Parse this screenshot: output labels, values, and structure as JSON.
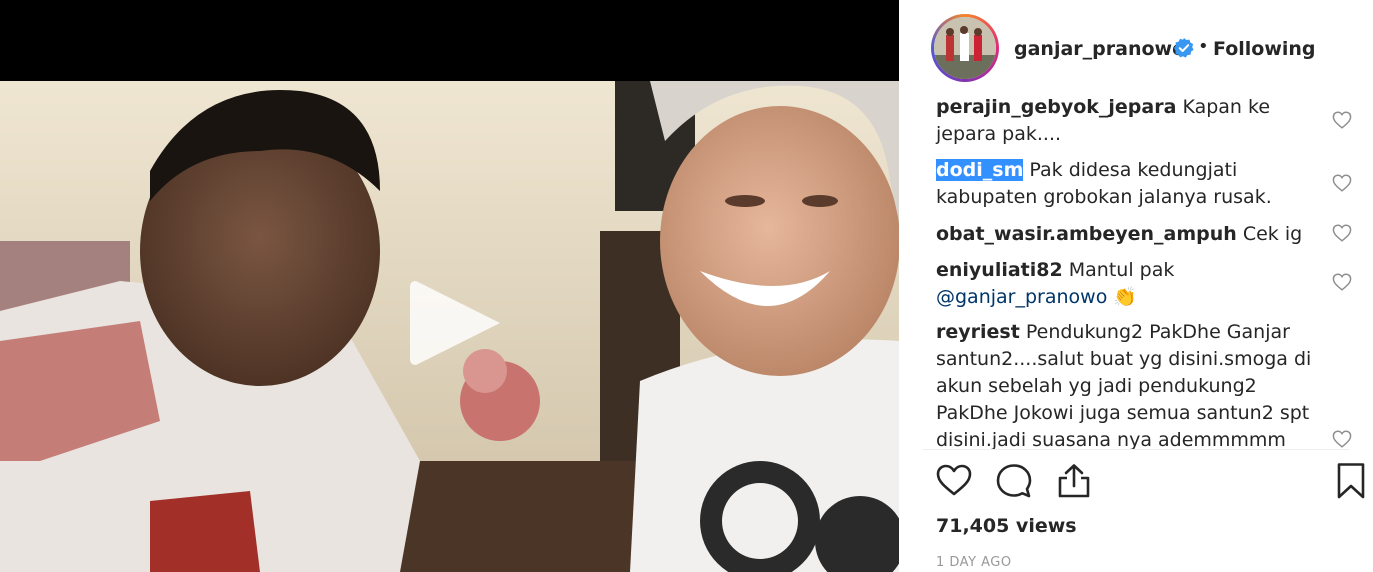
{
  "post": {
    "username": "ganjar_pranowo",
    "follow_separator": "•",
    "follow_status": "Following",
    "views": "71,405 views",
    "time_ago": "1 DAY AGO"
  },
  "comments": [
    {
      "user": "perajin_gebyok_jepara",
      "text": " Kapan ke jepara pak...."
    },
    {
      "user": "dodi_sm",
      "text": " Pak didesa kedungjati kabupaten grobokan jalanya rusak."
    },
    {
      "user": "obat_wasir.ambeyen_ampuh",
      "text": " Cek ig"
    },
    {
      "user": "eniyuliati82",
      "text": " Mantul pak",
      "mention": "@ganjar_pranowo",
      "emoji": "👏"
    },
    {
      "user": "reyriest",
      "text": " Pendukung2 PakDhe Ganjar santun2....salut buat yg disini.smoga di akun sebelah yg jadi pendukung2 PakDhe Jokowi juga semua santun2 spt disini.jadi suasana nya ademmmmm"
    }
  ],
  "icons": {
    "play": "play-icon",
    "verified": "verified-badge-icon",
    "like": "heart-icon",
    "comment": "comment-icon",
    "share": "share-icon",
    "save": "bookmark-icon"
  },
  "colors": {
    "verified": "#3897f0",
    "text": "#262626",
    "muted": "#999999",
    "selection": "#3390ff"
  }
}
